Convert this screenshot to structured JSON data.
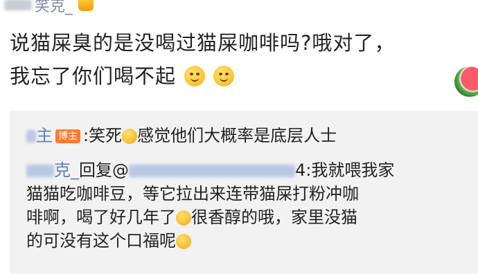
{
  "post": {
    "author_suffix": "笑克_",
    "text_line1": "说猫屎臭的是没喝过猫屎咖啡吗?哦对了，",
    "text_line2": "我忘了你们喝不起"
  },
  "comments": [
    {
      "author": "主",
      "badge": "博主",
      "text": ":笑死",
      "text2": "感觉他们大概率是底层人士"
    },
    {
      "author": "克_",
      "reply_label": "回复@",
      "reply_tail": "4:我就喂我家",
      "line2": "猫猫吃咖啡豆，等它拉出来连带猫屎打粉冲咖",
      "line3_a": "啡啊，喝了好几年了",
      "line3_b": "很香醇的哦，家里没猫",
      "line4": "的可没有这个口福呢"
    }
  ],
  "icons": {
    "crown": "crown-icon",
    "wink": "wink-emoji-icon",
    "cover-mouth": "cover-mouth-emoji-icon",
    "laugh": "laugh-emoji-icon",
    "watermelon": "watermelon-icon",
    "hehe": "hehe-emoji-icon"
  }
}
